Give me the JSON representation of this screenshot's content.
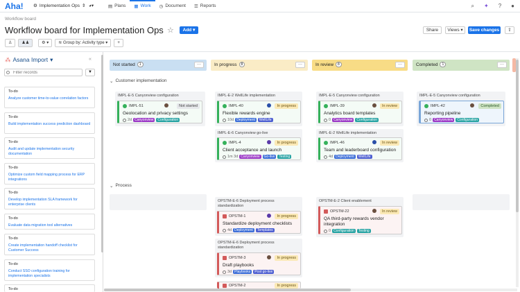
{
  "app": {
    "logo": "Aha!",
    "workspace": "Implementation Ops"
  },
  "nav": {
    "tabs": [
      "Plans",
      "Work",
      "Document",
      "Reports"
    ],
    "active": "Work"
  },
  "page": {
    "breadcrumb": "Workflow board",
    "title": "Workflow board for Implementation Ops",
    "add_label": "Add",
    "share_label": "Share",
    "views_label": "Views",
    "save_label": "Save changes"
  },
  "toolbar": {
    "group_by": "Group by: Activity type"
  },
  "sidebar": {
    "title": "Asana Import",
    "search_placeholder": "Filter records",
    "items": [
      {
        "status": "To-do",
        "title": "Analyze customer time-to-value correlation factors"
      },
      {
        "status": "To-do",
        "title": "Build implementation success prediction dashboard"
      },
      {
        "status": "To-do",
        "title": "Audit and update implementation security documentation"
      },
      {
        "status": "To-do",
        "title": "Optimize custom field mapping process for ERP integrations"
      },
      {
        "status": "To-do",
        "title": "Develop implementation SLA framework for enterprise clients"
      },
      {
        "status": "To-do",
        "title": "Evaluate data migration tool alternatives"
      },
      {
        "status": "To-do",
        "title": "Create implementation handoff checklist for Customer Success"
      },
      {
        "status": "To-do",
        "title": "Conduct SSO configuration training for implementation specialists"
      },
      {
        "status": "To-do",
        "title": ""
      }
    ]
  },
  "columns": [
    {
      "name": "Not started",
      "count": "1",
      "color": "#c9dff2"
    },
    {
      "name": "In progress",
      "count": "8",
      "color": "#faecc6"
    },
    {
      "name": "In review",
      "count": "8",
      "color": "#f8dc86"
    },
    {
      "name": "Completed",
      "count": "1",
      "color": "#cfe4c4"
    }
  ],
  "lanes": {
    "customer": "Customer implementation",
    "process": "Process"
  },
  "groups": {
    "g1": "IMPL-E-5 Canyonview configuration",
    "g2": "IMPL-E-2 WellLife implementation",
    "g3": "IMPL-E-6 Canyonview go-live",
    "g4": "IMPL-E-5 Canyonview configuration",
    "g5": "IMPL-E-2 WellLife implementation",
    "g6": "IMPL-E-5 Canyonview configuration",
    "g7": "OPSTM-E-6 Deployment process standardization",
    "g8": "OPSTM-E-2 Client enablement",
    "g9": "OPSTM-E-6 Deployment process standardization"
  },
  "cards": {
    "c1": {
      "id": "IMPL-51",
      "status": "Not started",
      "name": "Geolocation and privacy settings",
      "est": "2d",
      "tags": [
        "Canyonview",
        "Configuration"
      ]
    },
    "c2": {
      "id": "IMPL-40",
      "status": "In progress",
      "name": "Flexible rewards engine",
      "est": "10d",
      "tags": [
        "Deployment",
        "WellLife"
      ]
    },
    "c3": {
      "id": "IMPL-4",
      "status": "In progress",
      "name": "Client acceptance and launch",
      "est": "1m 3d",
      "tags": [
        "Canyonview",
        "Go-live",
        "Testing"
      ]
    },
    "c4": {
      "id": "IMPL-39",
      "status": "In review",
      "name": "Analytics board templates",
      "est": "0",
      "tags": [
        "Canyonview",
        "Configuration"
      ]
    },
    "c5": {
      "id": "IMPL-46",
      "status": "In review",
      "name": "Team and leaderboard configuration",
      "est": "4d",
      "tags": [
        "Deployment",
        "WellLife"
      ]
    },
    "c6": {
      "id": "IMPL-42",
      "status": "Completed",
      "name": "Reporting pipeline",
      "est": "0",
      "tags": [
        "Canyonview",
        "Configuration"
      ]
    },
    "c7": {
      "id": "OPSTM-1",
      "status": "In progress",
      "name": "Standardize deployment checklists",
      "est": "4d",
      "tags": [
        "Deployment",
        "Templates"
      ]
    },
    "c8": {
      "id": "OPSTM-22",
      "status": "In review",
      "name": "QA third-party rewards vendor integration",
      "est": "0",
      "tags": [
        "Configuration",
        "Testing"
      ]
    },
    "c9": {
      "id": "OPSTM-3",
      "status": "In progress",
      "name": "Draft playbooks",
      "est": "3d",
      "tags": [
        "Playbooks",
        "Post go-live"
      ]
    },
    "c10": {
      "id": "OPSTM-2",
      "status": "In progress"
    }
  }
}
